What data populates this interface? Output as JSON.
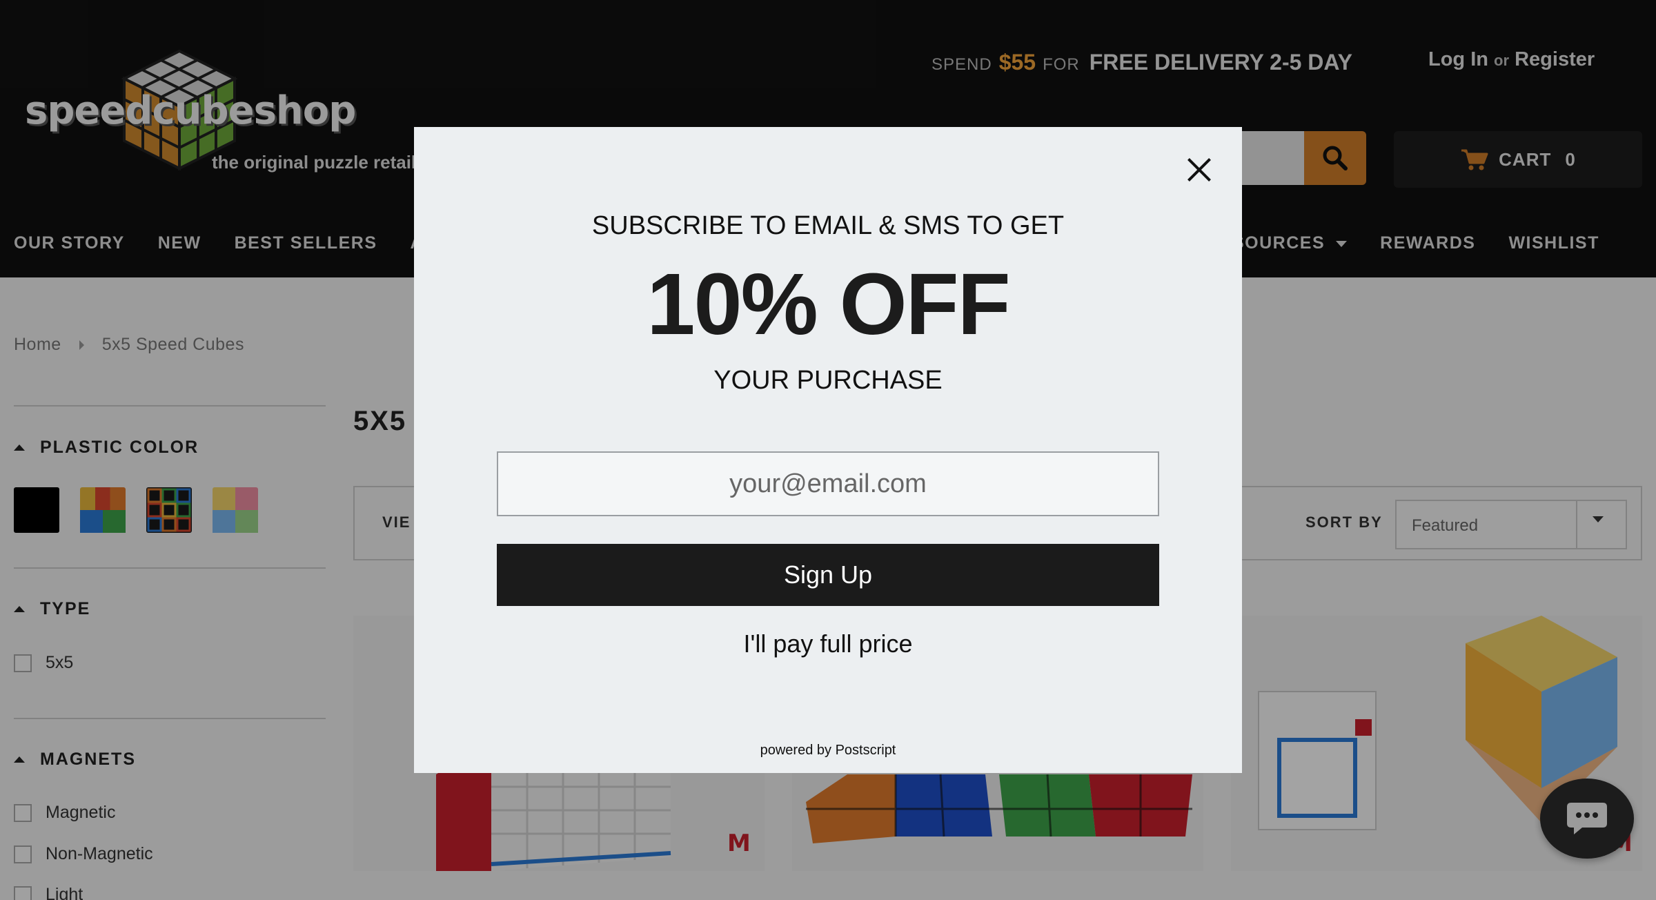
{
  "header": {
    "logo_text": "speedcubeshop",
    "logo_tagline": "the original puzzle retailer",
    "promo": {
      "spend": "SPEND",
      "amount": "$55",
      "for": "FOR",
      "delivery": "FREE DELIVERY 2-5 DAY"
    },
    "account": {
      "login": "Log In",
      "or": "or",
      "register": "Register"
    },
    "search_placeholder": "",
    "cart": {
      "label": "CART",
      "count": "0"
    },
    "nav_left": [
      "OUR STORY",
      "NEW",
      "BEST SELLERS",
      "AL"
    ],
    "nav_right": [
      "SOURCES",
      "REWARDS",
      "WISHLIST"
    ]
  },
  "breadcrumb": [
    "Home",
    "5x5 Speed Cubes"
  ],
  "sidebar": {
    "plastic_color": {
      "title": "PLASTIC COLOR",
      "swatches": [
        "black",
        "stickerless",
        "carbon-fiber",
        "pastel"
      ]
    },
    "type": {
      "title": "TYPE",
      "options": [
        "5x5"
      ]
    },
    "magnets": {
      "title": "MAGNETS",
      "options": [
        "Magnetic",
        "Non-Magnetic",
        "Light"
      ]
    }
  },
  "main": {
    "title": "5X5",
    "view_label": "VIE",
    "sort_label": "SORT BY",
    "sort_value": "Featured",
    "badge": "M"
  },
  "modal": {
    "line1": "SUBSCRIBE TO EMAIL & SMS TO GET",
    "headline": "10% OFF",
    "line2": "YOUR PURCHASE",
    "email_placeholder": "your@email.com",
    "signup_label": "Sign Up",
    "decline_label": "I'll pay full price",
    "powered_by": "powered by Postscript"
  },
  "colors": {
    "header_bg": "#111111",
    "accent_orange": "#d07e2a",
    "promo_orange": "#f5a53a",
    "badge_red": "#c8202c",
    "modal_bg": "#eceff1",
    "signup_bg": "#1b1b1b"
  },
  "icons": [
    "search-icon",
    "cart-icon",
    "close-icon",
    "chat-icon",
    "caret-down-icon",
    "caret-up-icon",
    "chevron-right-icon"
  ]
}
